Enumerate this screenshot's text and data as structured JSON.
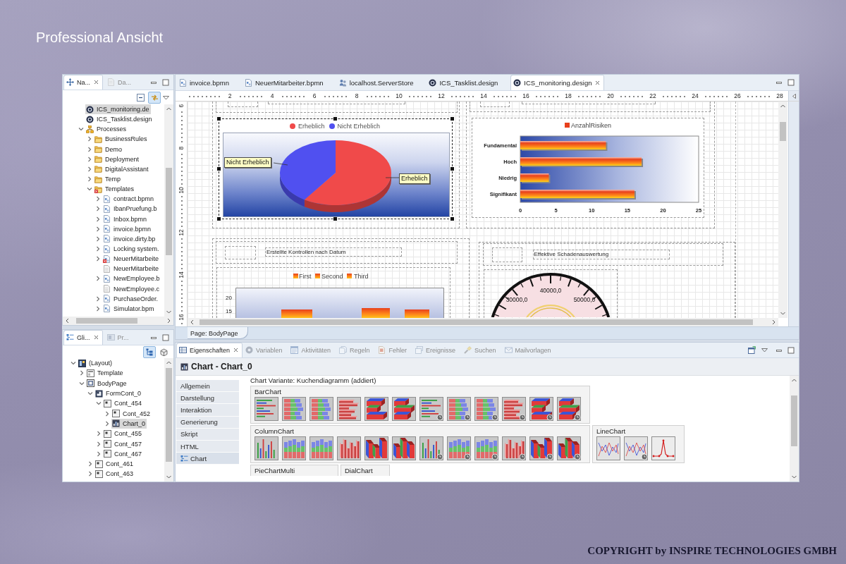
{
  "slide": {
    "title": "Professional Ansicht",
    "copyright": "COPYRIGHT by INSPIRE TECHNOLOGIES GMBH"
  },
  "navigator": {
    "tabs": [
      {
        "label": "Na...",
        "kind": "navigator",
        "selected": true
      },
      {
        "label": "Da...",
        "kind": "data",
        "selected": false
      }
    ],
    "toolbar": [
      {
        "kind": "collapse",
        "on": false
      },
      {
        "kind": "link",
        "on": true
      }
    ],
    "tree": [
      {
        "label": "ICS_monitoring.de",
        "kind": "design",
        "error": false,
        "selected": true
      },
      {
        "label": "ICS_Tasklist.design",
        "kind": "design",
        "error": false,
        "selected": false
      },
      {
        "label": "Processes",
        "kind": "processes",
        "error": false,
        "selected": false,
        "expanded": true,
        "children": [
          {
            "label": "BusinessRules",
            "kind": "folder",
            "error": false,
            "selected": false,
            "expanded": false
          },
          {
            "label": "Demo",
            "kind": "folder",
            "error": false,
            "selected": false,
            "expanded": false
          },
          {
            "label": "Deployment",
            "kind": "folder",
            "error": false,
            "selected": false,
            "expanded": false
          },
          {
            "label": "DigitalAssistant",
            "kind": "folder",
            "error": false,
            "selected": false,
            "expanded": false
          },
          {
            "label": "Temp",
            "kind": "folder",
            "error": false,
            "selected": false,
            "expanded": false
          },
          {
            "label": "Templates",
            "kind": "folder",
            "error": true,
            "selected": false,
            "expanded": true,
            "children": [
              {
                "label": "contract.bpmn",
                "kind": "bpmn",
                "error": false,
                "selected": false,
                "expanded": false
              },
              {
                "label": "IbanPruefung.b",
                "kind": "bpmn",
                "error": false,
                "selected": false,
                "expanded": false
              },
              {
                "label": "Inbox.bpmn",
                "kind": "bpmn",
                "error": false,
                "selected": false,
                "expanded": false
              },
              {
                "label": "invoice.bpmn",
                "kind": "bpmn",
                "error": false,
                "selected": false,
                "expanded": false
              },
              {
                "label": "invoice.dirty.bp",
                "kind": "bpmn",
                "error": false,
                "selected": false,
                "expanded": false
              },
              {
                "label": "Locking system.",
                "kind": "bpmn",
                "error": false,
                "selected": false,
                "expanded": false
              },
              {
                "label": "NeuerMitarbeite",
                "kind": "bpmn",
                "error": true,
                "selected": false,
                "expanded": false
              },
              {
                "label": "NeuerMitarbeite",
                "kind": "file",
                "error": false,
                "selected": false
              },
              {
                "label": "NewEmployee.b",
                "kind": "bpmn",
                "error": false,
                "selected": false,
                "expanded": false
              },
              {
                "label": "NewEmployee.c",
                "kind": "file",
                "error": false,
                "selected": false
              },
              {
                "label": "PurchaseOrder.",
                "kind": "bpmn",
                "error": false,
                "selected": false,
                "expanded": false
              },
              {
                "label": "Simulator.bpm",
                "kind": "bpmn",
                "error": false,
                "selected": false,
                "expanded": false
              }
            ]
          }
        ]
      }
    ]
  },
  "outline": {
    "tabs": [
      {
        "label": "Gli...",
        "kind": "outline",
        "selected": true
      },
      {
        "label": "Pr...",
        "kind": "palette",
        "selected": false
      }
    ],
    "toolbar": [
      {
        "kind": "tree",
        "on": true
      },
      {
        "kind": "box",
        "on": false
      }
    ],
    "tree": [
      {
        "label": "(Layout)",
        "kind": "layout",
        "selected": false,
        "expanded": true,
        "children": [
          {
            "label": "Template",
            "kind": "template",
            "selected": false,
            "expanded": false
          },
          {
            "label": "BodyPage",
            "kind": "page",
            "selected": false,
            "expanded": true,
            "children": [
              {
                "label": "FormCont_0",
                "kind": "form",
                "selected": false,
                "expanded": true,
                "children": [
                  {
                    "label": "Cont_454",
                    "kind": "container",
                    "selected": false,
                    "expanded": true,
                    "children": [
                      {
                        "label": "Cont_452",
                        "kind": "container",
                        "selected": false,
                        "expanded": false
                      },
                      {
                        "label": "Chart_0",
                        "kind": "chart",
                        "selected": true,
                        "expanded": false
                      }
                    ]
                  },
                  {
                    "label": "Cont_455",
                    "kind": "container",
                    "selected": false,
                    "expanded": false
                  },
                  {
                    "label": "Cont_457",
                    "kind": "container",
                    "selected": false,
                    "expanded": false
                  },
                  {
                    "label": "Cont_467",
                    "kind": "container",
                    "selected": false,
                    "expanded": false
                  }
                ]
              },
              {
                "label": "Cont_461",
                "kind": "container",
                "selected": false,
                "expanded": false
              },
              {
                "label": "Cont_463",
                "kind": "container",
                "selected": false,
                "expanded": false
              }
            ]
          }
        ]
      }
    ]
  },
  "editor": {
    "tabs": [
      {
        "label": "invoice.bpmn",
        "kind": "bpmn",
        "selected": false
      },
      {
        "label": "NeuerMitarbeiter.bpmn",
        "kind": "bpmn",
        "selected": false
      },
      {
        "label": "localhost.ServerStore",
        "kind": "server",
        "selected": false
      },
      {
        "label": "ICS_Tasklist.design",
        "kind": "design",
        "selected": false
      },
      {
        "label": "ICS_monitoring.design",
        "kind": "design",
        "selected": true
      }
    ],
    "ruler": {
      "horizontal": [
        "2",
        "4",
        "6",
        "8",
        "10",
        "12",
        "14",
        "16",
        "18",
        "20",
        "22",
        "24",
        "26",
        "28"
      ],
      "vertical": [
        "6",
        "8",
        "10",
        "12",
        "14",
        "16"
      ]
    },
    "pie_chart": {
      "slices": [
        {
          "legend": "Erheblich",
          "callout": "Erheblich",
          "color": "#f04a4a"
        },
        {
          "legend": "Nicht Erheblich",
          "callout": "Nicht Erheblich",
          "color": "#5050f0"
        }
      ]
    },
    "bar_chart": {
      "chart_data": {
        "type": "bar",
        "orientation": "horizontal",
        "categories": [
          "Fundamental",
          "Hoch",
          "Niedrig",
          "Signifikant"
        ],
        "series": [
          {
            "name": "AnzahlRisiken",
            "color": "#e8401c",
            "values": [
              12,
              17,
              4,
              16
            ]
          }
        ],
        "xlim": [
          0,
          25
        ],
        "xticks": [
          0,
          5,
          10,
          15,
          20,
          25
        ]
      }
    },
    "left_section": {
      "caption": "Erstellte Kontrollen nach Datum",
      "column_chart": {
        "legend": [
          "First",
          "Second",
          "Third"
        ],
        "y_labels": [
          "20",
          "15"
        ]
      }
    },
    "right_section": {
      "caption": "Effektive Schadenauswertung",
      "gauge": {
        "labels": [
          "30000,0",
          "40000,0",
          "50000,0"
        ]
      }
    },
    "page_tab": "Page: BodyPage"
  },
  "properties": {
    "tabs": [
      {
        "label": "Eigenschaften",
        "kind": "table",
        "selected": true
      },
      {
        "label": "Variablen",
        "kind": "variables",
        "selected": false
      },
      {
        "label": "Aktivitäten",
        "kind": "activities",
        "selected": false
      },
      {
        "label": "Regeln",
        "kind": "rules",
        "selected": false
      },
      {
        "label": "Fehler",
        "kind": "errors",
        "selected": false
      },
      {
        "label": "Ereignisse",
        "kind": "events",
        "selected": false
      },
      {
        "label": "Suchen",
        "kind": "search",
        "selected": false
      },
      {
        "label": "Mailvorlagen",
        "kind": "mail",
        "selected": false
      }
    ],
    "title": "Chart - Chart_0",
    "sections": [
      {
        "label": "Allgemein",
        "selected": false
      },
      {
        "label": "Darstellung",
        "selected": false
      },
      {
        "label": "Interaktion",
        "selected": false
      },
      {
        "label": "Generierung",
        "selected": false
      },
      {
        "label": "Skript",
        "selected": false
      },
      {
        "label": "HTML",
        "selected": false
      },
      {
        "label": "Chart",
        "selected": true
      }
    ],
    "variant": "Chart Variante: Kuchendiagramm (addiert)",
    "chart_type_rows": [
      [
        {
          "label": "BarChart",
          "kind": "bar"
        }
      ],
      [
        {
          "label": "ColumnChart",
          "kind": "column"
        },
        {
          "label": "LineChart",
          "kind": "line"
        }
      ],
      [
        {
          "label": "PieChartMulti",
          "kind": "pie"
        },
        {
          "label": "DialChart",
          "kind": "dial"
        }
      ]
    ]
  }
}
